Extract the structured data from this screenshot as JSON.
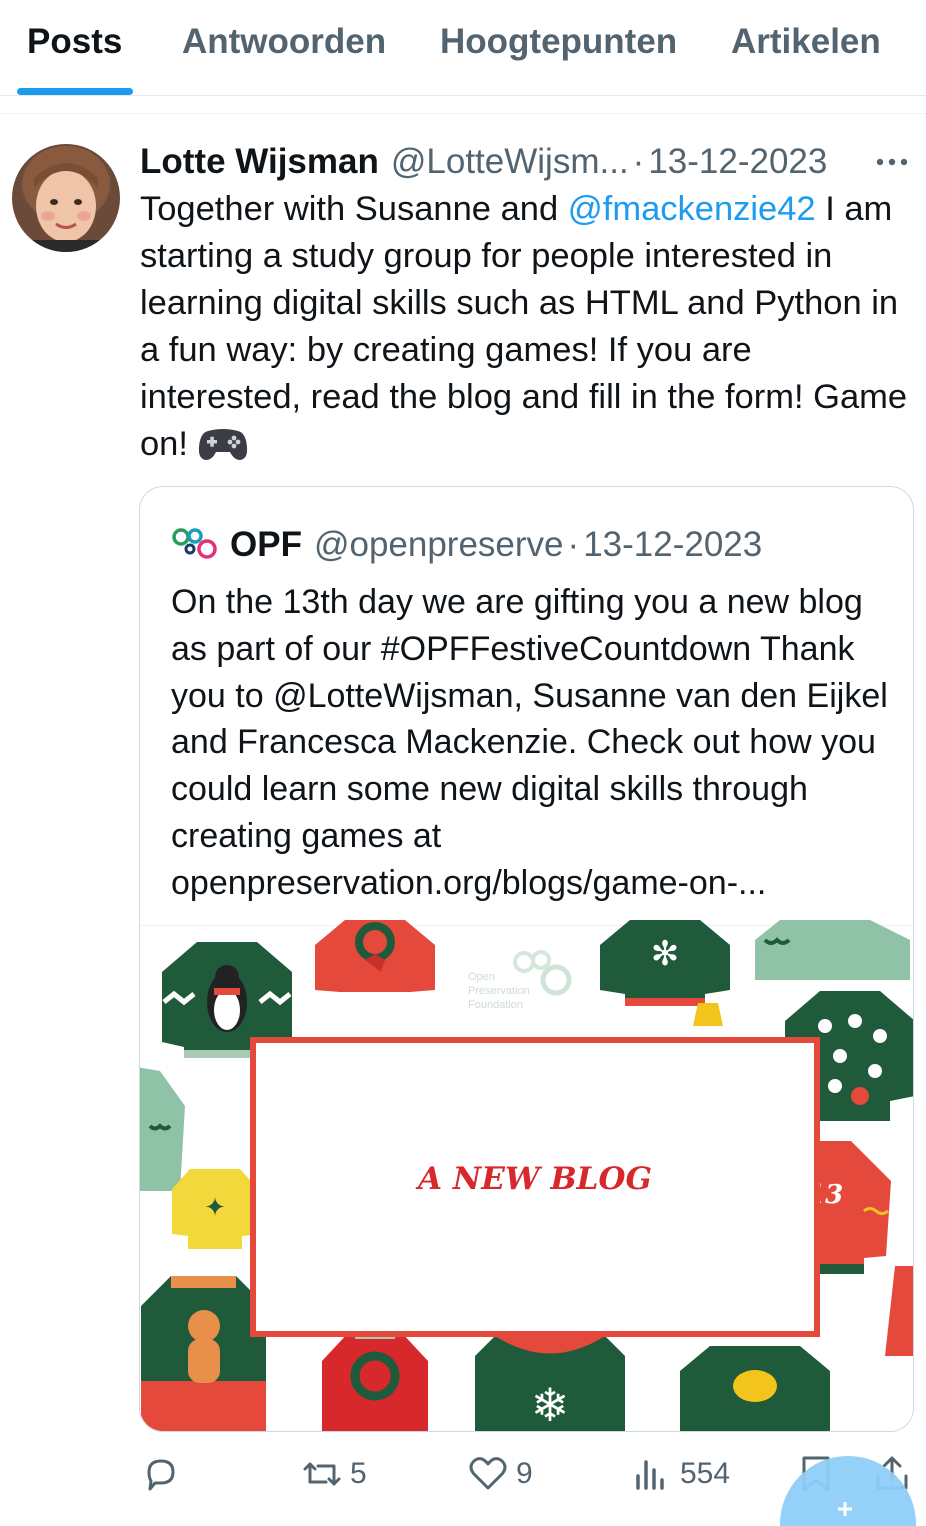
{
  "tabs": [
    {
      "label": "Posts",
      "active": true
    },
    {
      "label": "Antwoorden",
      "active": false
    },
    {
      "label": "Hoogtepunten",
      "active": false
    },
    {
      "label": "Artikelen",
      "active": false
    }
  ],
  "post": {
    "author_name": "Lotte Wijsman",
    "author_handle": "@LotteWijsm...",
    "separator": "·",
    "date": "13-12-2023",
    "text_before_mention": "Together with Susanne and ",
    "mention": "@fmackenzie42",
    "text_after_mention": " I am starting a study group for people interested in learning digital skills such as HTML and Python in a fun way: by creating games! If you are interested, read the blog and fill in the form! Game on! ",
    "emoji_icon": "gamepad-icon"
  },
  "quote": {
    "author_name": "OPF",
    "author_handle": "@openpreserve",
    "separator": "·",
    "date": "13-12-2023",
    "text": "On the 13th day we are gifting you a new blog as part of our #OPFFestiveCountdown Thank you to @LotteWijsman, Susanne van den Eijkel and Francesca Mackenzie. Check out how you could learn some new digital skills through creating games at openpreservation.org/blogs/game-on-...",
    "image": {
      "title": "A NEW BLOG",
      "watermark": [
        "Open",
        "Preservation",
        "Foundation"
      ],
      "sweater_number": "13"
    }
  },
  "actions": {
    "replies": "",
    "reposts": "5",
    "likes": "9",
    "views": "554"
  },
  "colors": {
    "accent": "#1d9bf0",
    "text": "#0f1419",
    "muted": "#536471",
    "sweater_red": "#e4493b",
    "sweater_green": "#1f5a3a"
  }
}
